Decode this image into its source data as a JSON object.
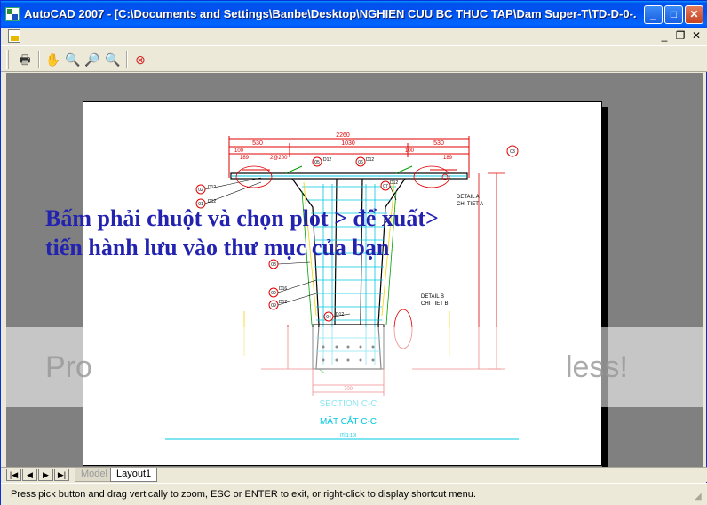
{
  "window": {
    "title": "AutoCAD 2007 - [C:\\Documents and Settings\\Banbe\\Desktop\\NGHIEN CUU BC THUC TAP\\Dam Super-T\\TD-D-0-..."
  },
  "overlay": {
    "line1": "Bấm phải chuột và chọn plot > để xuất>",
    "line2": "tiến hành lưu vào thư mục của bạn"
  },
  "drawing": {
    "section_title": "SECTION C-C",
    "section_subtitle": "MẶT CẮT C-C",
    "scale": "(Tỉ 1:10)",
    "dims_top": "2260",
    "dim_530a": "530",
    "dim_1030": "1030",
    "dim_530b": "530",
    "dim_100a": "100",
    "dim_100b": "100",
    "dim_189a": "189",
    "dim_189b": "189",
    "dim_2a200": "2@200",
    "detail_a": "DETAIL A",
    "detail_a_sub": "CHI TIET A",
    "detail_b": "DETAIL B",
    "detail_b_sub": "CHI TIET B",
    "bottom_dim": "700",
    "labels": [
      "01",
      "02",
      "03",
      "04",
      "05",
      "06",
      "07",
      "08",
      "09"
    ],
    "bar_d12": "D12",
    "bar_d16": "D16"
  },
  "watermark": {
    "left": "Pro",
    "right": "less!"
  },
  "tabs": {
    "model": "Model",
    "layout1": "Layout1"
  },
  "status": {
    "message": "Press pick button and drag vertically to zoom, ESC or ENTER to exit, or right-click to display shortcut menu."
  },
  "colors": {
    "title_blue": "#0053ee",
    "overlay_text": "#2323b0",
    "dim_red": "#e00000",
    "cyan": "#00c8e0",
    "green": "#00a000"
  }
}
